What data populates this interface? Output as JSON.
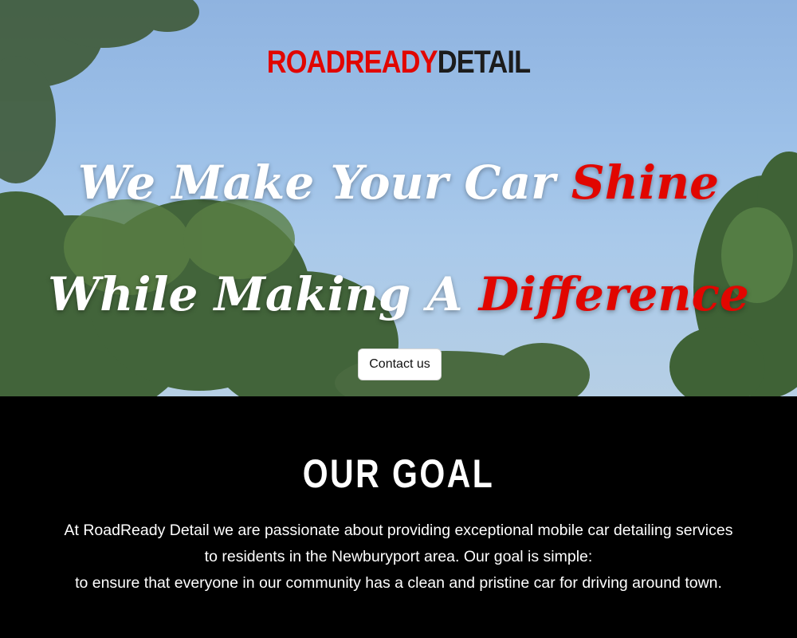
{
  "brand": {
    "part1": "ROADREADY",
    "part2": "DETAIL",
    "accent_color": "#e10600",
    "dark_color": "#1c1c1c"
  },
  "hero": {
    "line1_text": "We Make Your Car ",
    "line1_accent": "Shine",
    "line2_text": "While Making A ",
    "line2_accent": "Difference",
    "contact_label": "Contact us"
  },
  "goal": {
    "title": "OUR GOAL",
    "lines": [
      "At RoadReady Detail we are passionate about providing exceptional mobile car detailing services",
      "to residents in the Newburyport area. Our goal is simple:",
      "to ensure that everyone in our community has a clean and pristine car for driving around town."
    ]
  }
}
